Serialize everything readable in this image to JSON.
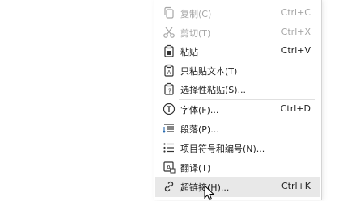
{
  "context_menu": {
    "items": [
      {
        "label": "复制(C)",
        "shortcut": "Ctrl+C",
        "icon": "copy-icon",
        "enabled": false
      },
      {
        "label": "剪切(T)",
        "shortcut": "Ctrl+X",
        "icon": "cut-icon",
        "enabled": false
      },
      {
        "label": "粘贴",
        "shortcut": "Ctrl+V",
        "icon": "paste-icon",
        "enabled": true
      },
      {
        "label": "只粘贴文本(T)",
        "shortcut": "",
        "icon": "paste-text-only-icon",
        "enabled": true
      },
      {
        "label": "选择性粘贴(S)...",
        "shortcut": "",
        "icon": "paste-special-icon",
        "enabled": true
      },
      {
        "label": "字体(F)...",
        "shortcut": "Ctrl+D",
        "icon": "font-icon",
        "enabled": true
      },
      {
        "label": "段落(P)...",
        "shortcut": "",
        "icon": "paragraph-icon",
        "enabled": true
      },
      {
        "label": "项目符号和编号(N)...",
        "shortcut": "",
        "icon": "bullets-numbering-icon",
        "enabled": true
      },
      {
        "label": "翻译(T)",
        "shortcut": "",
        "icon": "translate-icon",
        "enabled": true
      },
      {
        "label": "超链接(H)...",
        "shortcut": "Ctrl+K",
        "icon": "hyperlink-icon",
        "enabled": true,
        "hovered": true
      }
    ]
  },
  "colors": {
    "disabled_text": "#a6a6a6",
    "text": "#1f1f1f",
    "hover_bg": "#e8e8e8"
  }
}
